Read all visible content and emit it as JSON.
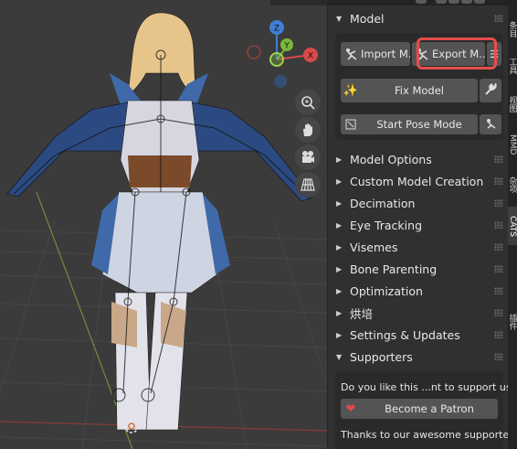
{
  "colors": {
    "accent_red": "#e84d4d",
    "axis_x": "#d84a4a",
    "axis_y": "#7ab63c",
    "axis_z": "#3f7fd6",
    "panel_bg": "#303030",
    "box_bg": "#2a2a2a",
    "button_bg": "#545454"
  },
  "viewport": {
    "gizmo": {
      "x_label": "X",
      "y_label": "Y",
      "z_label": "Z"
    },
    "tools": [
      {
        "icon": "zoom-icon"
      },
      {
        "icon": "hand-icon"
      },
      {
        "icon": "camera-icon"
      },
      {
        "icon": "grid-icon"
      }
    ]
  },
  "panel": {
    "model": {
      "title": "Model",
      "import_label": "Import M...",
      "export_label": "Export M...",
      "fix_label": "Fix Model",
      "pose_label": "Start Pose Mode"
    },
    "sections": [
      {
        "label": "Model Options"
      },
      {
        "label": "Custom Model Creation"
      },
      {
        "label": "Decimation"
      },
      {
        "label": "Eye Tracking"
      },
      {
        "label": "Visemes"
      },
      {
        "label": "Bone Parenting"
      },
      {
        "label": "Optimization"
      },
      {
        "label": "烘培"
      },
      {
        "label": "Settings & Updates"
      }
    ],
    "supporters": {
      "title": "Supporters",
      "prompt": "Do you like this ...nt to support us?",
      "patron_label": "Become a Patron",
      "thanks": "Thanks to our awesome supporte..."
    }
  },
  "tabs": [
    {
      "label": "条目"
    },
    {
      "label": "工具"
    },
    {
      "label": "视图"
    },
    {
      "label": "MMD"
    },
    {
      "label": "杂项"
    },
    {
      "label": "CATS"
    },
    {
      "label": "插件"
    }
  ]
}
